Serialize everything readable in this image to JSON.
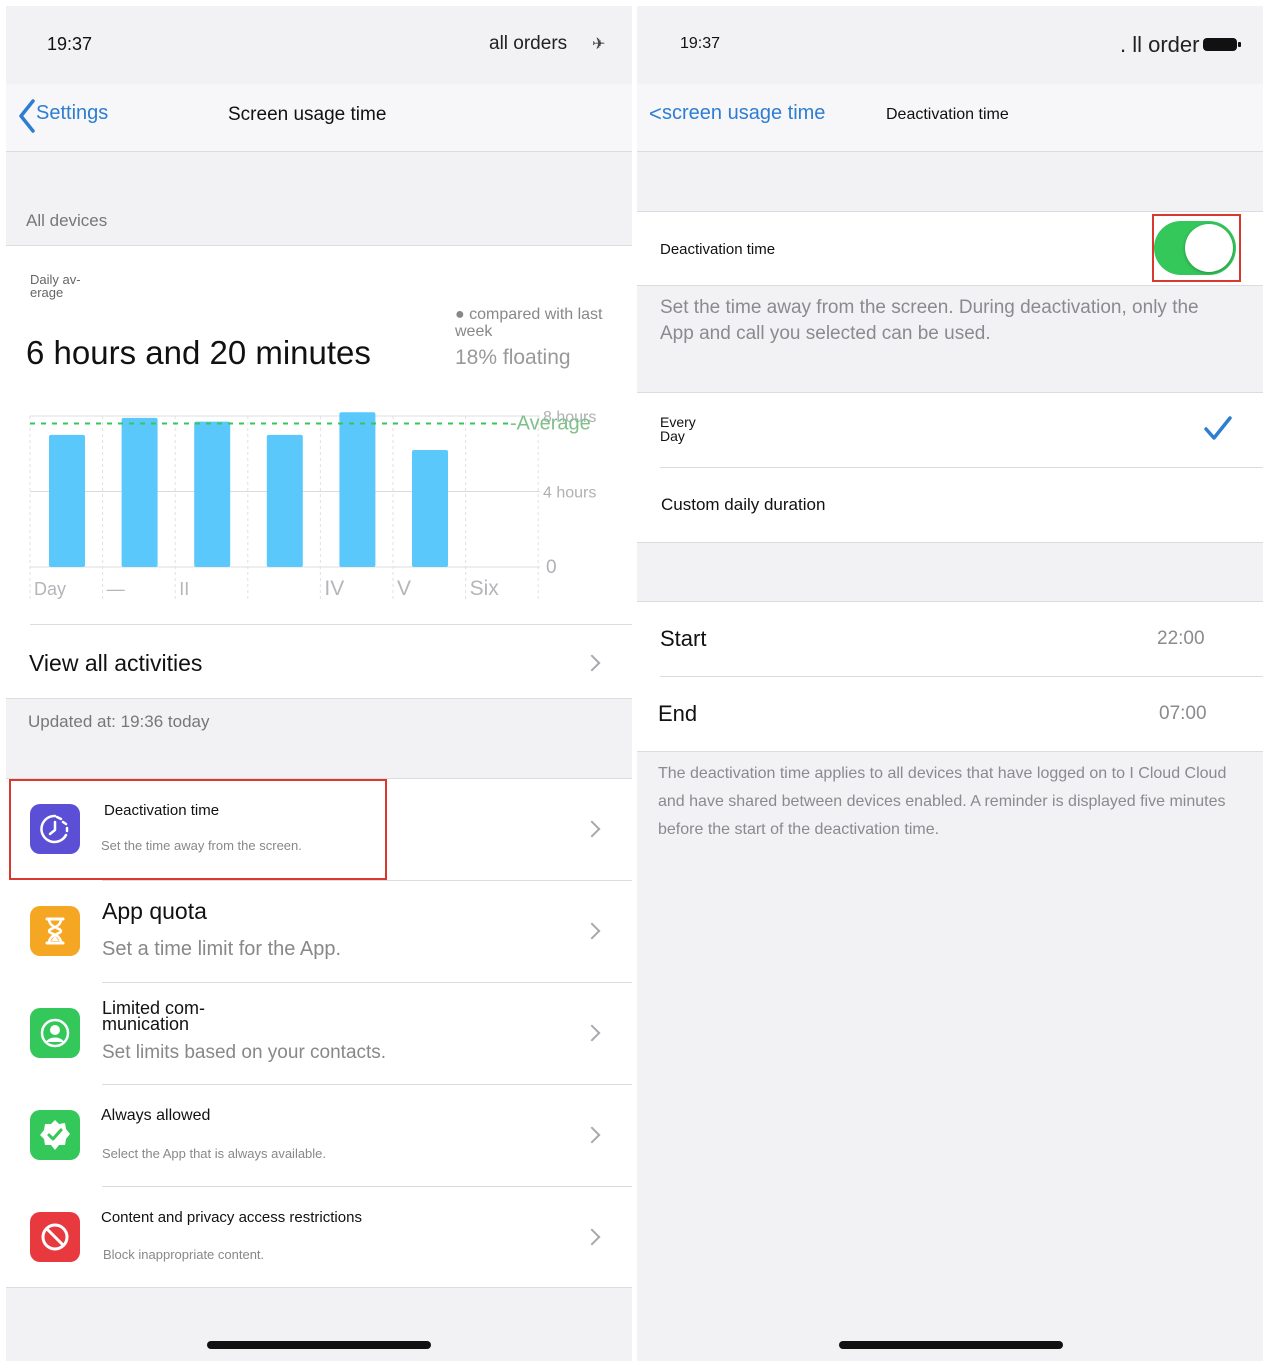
{
  "left_screen": {
    "status": {
      "time": "19:37",
      "carrier": "all orders"
    },
    "nav": {
      "back_label": "Settings",
      "title": "Screen usage time"
    },
    "all_devices_label": "All devices",
    "summary": {
      "daily_average_label_line1": "Daily av-",
      "daily_average_label_line2": "erage",
      "total": "6 hours and 20 minutes",
      "compared_line1": "● compared with last",
      "compared_line2": "week",
      "floating": "18% floating"
    },
    "view_all": "View all activities",
    "updated": "Updated at: 19:36 today",
    "list": [
      {
        "title": "Deactivation time",
        "subtitle": "Set the time away from the screen.",
        "icon": "moon-clock-icon",
        "color": "#5b4fd6"
      },
      {
        "title": "App quota",
        "subtitle": "Set a time limit for the App.",
        "icon": "hourglass-icon",
        "color": "#f5a623"
      },
      {
        "title_line1": "Limited com-",
        "title_line2": "munication",
        "subtitle": "Set limits based on your contacts.",
        "icon": "person-circle-icon",
        "color": "#34c759"
      },
      {
        "title": "Always allowed",
        "subtitle": "Select the App that is always available.",
        "icon": "check-badge-icon",
        "color": "#34c759"
      },
      {
        "title": "Content and privacy access restrictions",
        "subtitle": "Block inappropriate content.",
        "icon": "no-entry-icon",
        "color": "#e8393f"
      }
    ]
  },
  "right_screen": {
    "status": {
      "time": "19:37",
      "carrier": ". ll order"
    },
    "nav": {
      "back_label": "screen usage time",
      "title": "Deactivation time"
    },
    "toggle": {
      "label": "Deactivation time",
      "on": true
    },
    "description": "Set the time away from the screen. During deactivation, only the App and call you selected can be used.",
    "every_day_line1": "Every",
    "every_day_line2": "Day",
    "custom": "Custom daily duration",
    "start_label": "Start",
    "start_value": "22:00",
    "end_label": "End",
    "end_value": "07:00",
    "footer": "The deactivation time applies to all devices that have logged on to I Cloud Cloud and have shared between devices enabled. A reminder is displayed five minutes before the start of the deactivation time."
  },
  "chart_data": {
    "type": "bar",
    "categories": [
      "Day",
      "—",
      "II",
      "",
      "IV",
      "V",
      "Six"
    ],
    "values": [
      7.0,
      7.9,
      7.7,
      7.0,
      8.2,
      6.2,
      0
    ],
    "ylim": [
      0,
      8
    ],
    "y_ticks": [
      {
        "value": 8,
        "label": "8 hours"
      },
      {
        "value": 4,
        "label": "4 hours"
      },
      {
        "value": 0,
        "label": "0"
      }
    ],
    "average": 7.6,
    "average_label": "-Average",
    "bar_color": "#5ac8fa",
    "average_color": "#34c759"
  }
}
